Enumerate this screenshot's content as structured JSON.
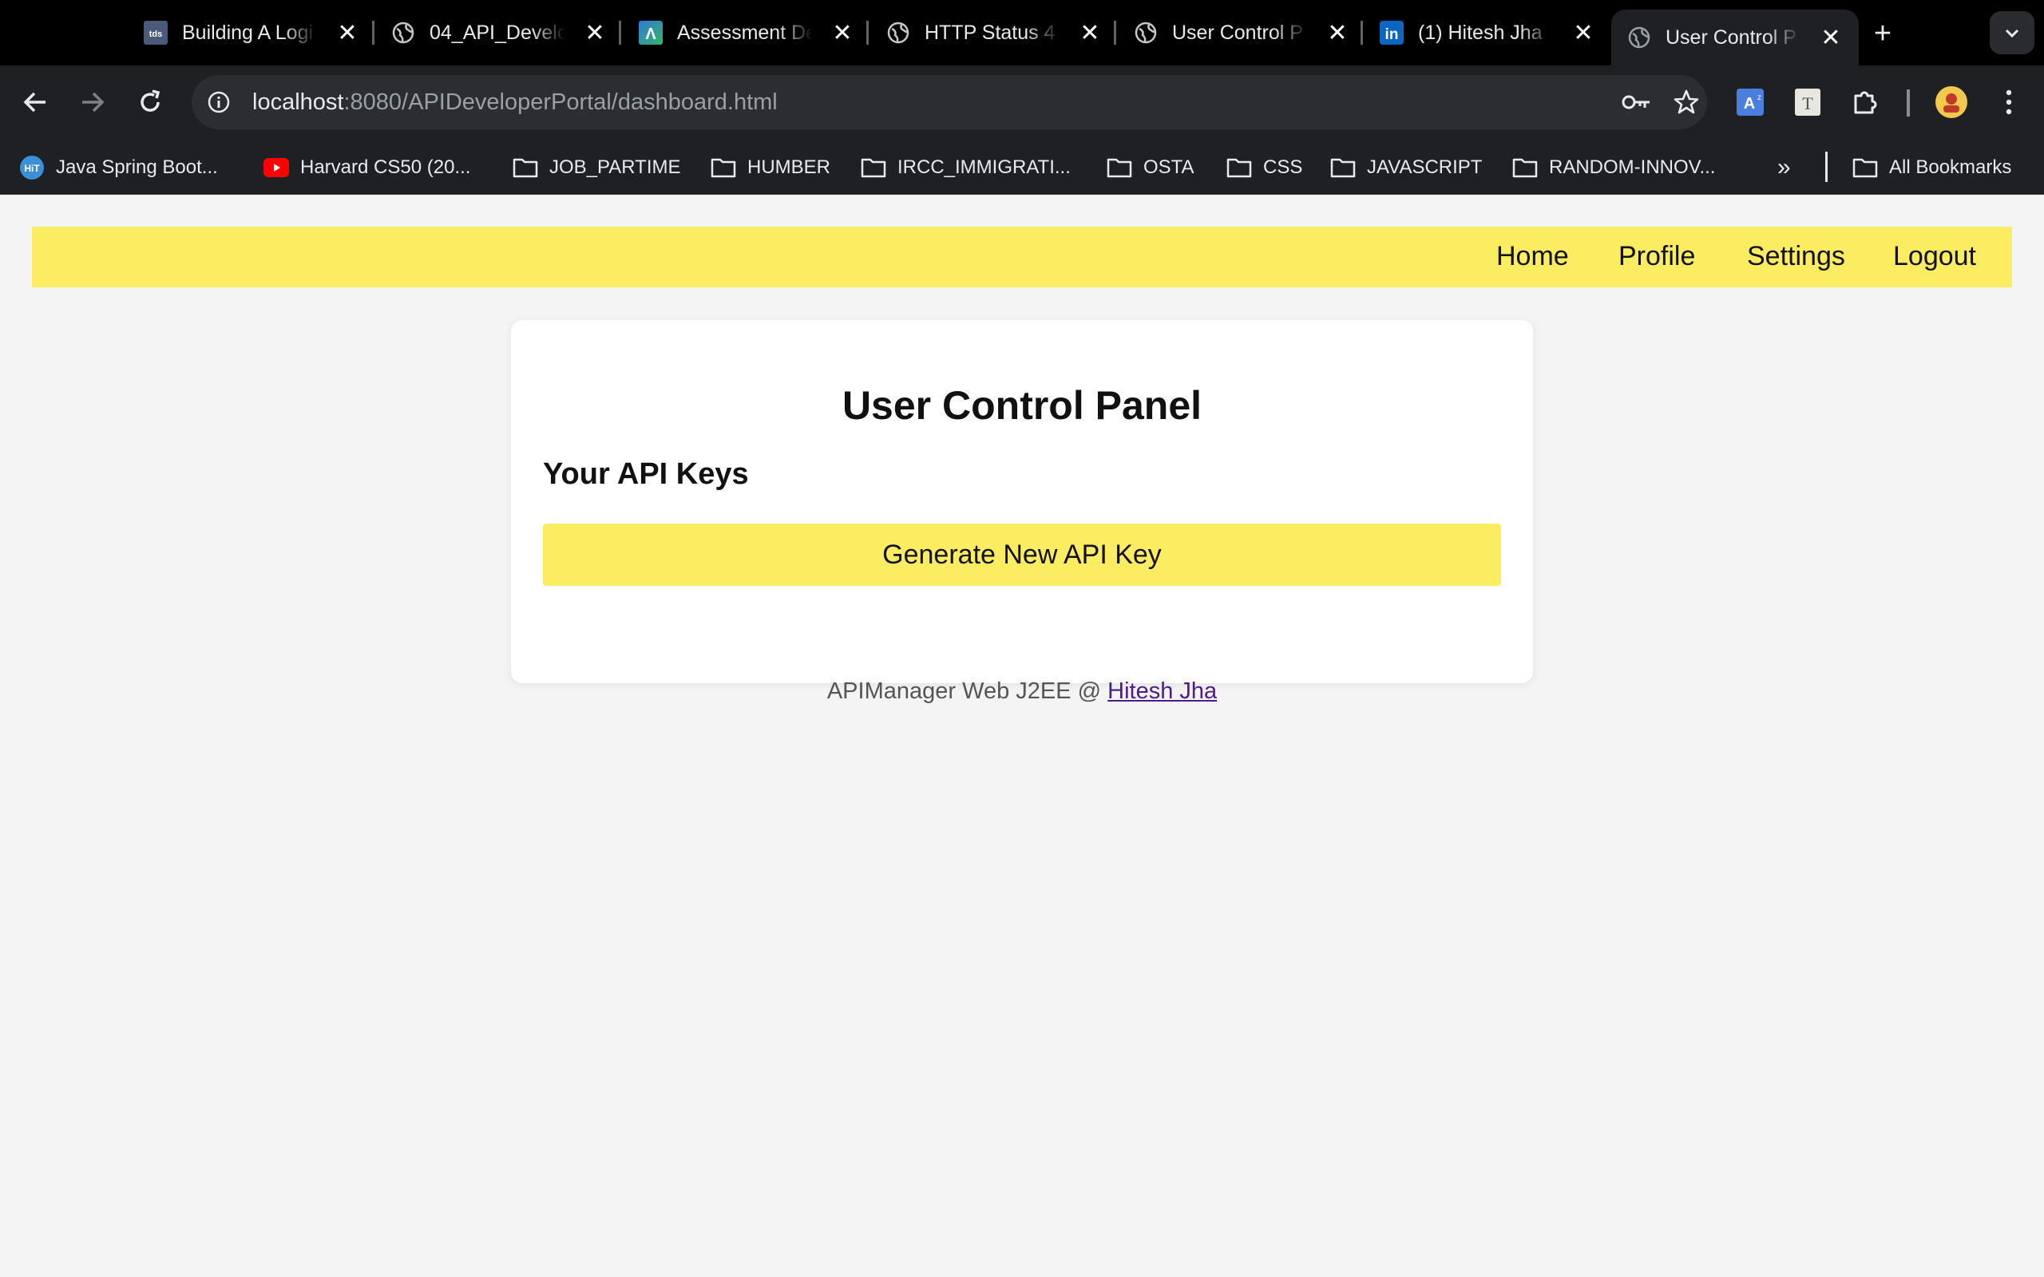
{
  "browser": {
    "tabs": [
      {
        "title": "Building A Logi",
        "icon": "tds-icon"
      },
      {
        "title": "04_API_Develo",
        "icon": "globe-icon"
      },
      {
        "title": "Assessment De",
        "icon": "assessment-icon"
      },
      {
        "title": "HTTP Status 4",
        "icon": "globe-icon"
      },
      {
        "title": "User Control P",
        "icon": "globe-icon"
      },
      {
        "title": "(1) Hitesh Jha",
        "icon": "linkedin-icon"
      },
      {
        "title": "User Control P",
        "icon": "globe-icon",
        "active": true
      }
    ],
    "favicon_text": {
      "tds": "tds",
      "assessment": "Λ",
      "linkedin": "in"
    },
    "url_host": "localhost",
    "url_path": ":8080/APIDeveloperPortal/dashboard.html",
    "bookmarks": [
      {
        "label": "Java Spring Boot...",
        "icon": "hit-icon",
        "icon_text": "HiT"
      },
      {
        "label": "Harvard CS50 (20...",
        "icon": "youtube-icon"
      },
      {
        "label": "JOB_PARTIME",
        "icon": "folder-icon"
      },
      {
        "label": "HUMBER",
        "icon": "folder-icon"
      },
      {
        "label": "IRCC_IMMIGRATI...",
        "icon": "folder-icon"
      },
      {
        "label": "OSTA",
        "icon": "folder-icon"
      },
      {
        "label": "CSS",
        "icon": "folder-icon"
      },
      {
        "label": "JAVASCRIPT",
        "icon": "folder-icon"
      },
      {
        "label": "RANDOM-INNOV...",
        "icon": "folder-icon"
      }
    ],
    "all_bookmarks": "All Bookmarks",
    "overflow": "»"
  },
  "site": {
    "nav": [
      "Home",
      "Profile",
      "Settings",
      "Logout"
    ],
    "panel_title": "User Control Panel",
    "section_title": "Your API Keys",
    "generate_button": "Generate New API Key",
    "footer_text": "APIManager Web J2EE @ ",
    "footer_link": "Hitesh Jha"
  },
  "colors": {
    "accent_yellow": "#fcec62",
    "page_bg": "#f4f4f4",
    "chrome_dark": "#1f2023",
    "link_visited": "#4b1d8a"
  }
}
